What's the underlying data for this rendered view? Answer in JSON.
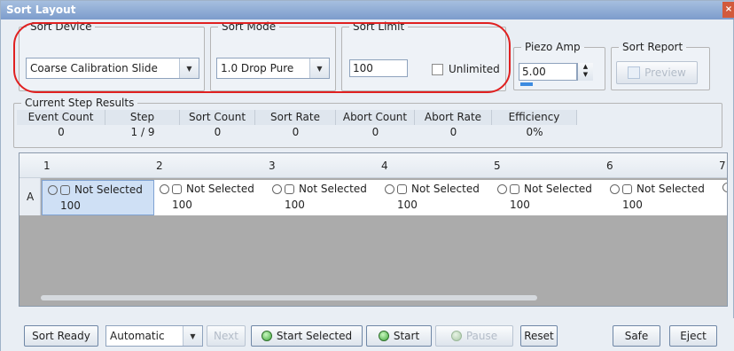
{
  "window": {
    "title": "Sort Layout",
    "close_glyph": "×"
  },
  "sort_device": {
    "legend": "Sort Device",
    "value": "Coarse Calibration Slide"
  },
  "sort_mode": {
    "legend": "Sort Mode",
    "value": "1.0 Drop Pure"
  },
  "sort_limit": {
    "legend": "Sort Limit",
    "value": "100",
    "unlimited_label": "Unlimited",
    "unlimited_checked": false
  },
  "piezo_amp": {
    "legend": "Piezo Amp",
    "value": "5.00"
  },
  "sort_report": {
    "legend": "Sort Report",
    "preview_label": "Preview"
  },
  "current_step": {
    "legend": "Current Step Results",
    "headers": [
      "Event Count",
      "Step",
      "Sort Count",
      "Sort Rate",
      "Abort Count",
      "Abort Rate",
      "Efficiency"
    ],
    "values": [
      "0",
      "1 / 9",
      "0",
      "0",
      "0",
      "0",
      "0%"
    ]
  },
  "grid": {
    "columns": [
      "1",
      "2",
      "3",
      "4",
      "5",
      "6",
      "7"
    ],
    "row_label": "A",
    "cells": [
      {
        "status": "Not Selected",
        "count": "100"
      },
      {
        "status": "Not Selected",
        "count": "100"
      },
      {
        "status": "Not Selected",
        "count": "100"
      },
      {
        "status": "Not Selected",
        "count": "100"
      },
      {
        "status": "Not Selected",
        "count": "100"
      },
      {
        "status": "Not Selected",
        "count": "100"
      }
    ]
  },
  "toolbar": {
    "sort_ready": "Sort Ready",
    "mode_value": "Automatic",
    "next": "Next",
    "start_selected": "Start Selected",
    "start": "Start",
    "pause": "Pause",
    "reset": "Reset",
    "safe": "Safe",
    "eject": "Eject"
  },
  "colors": {
    "highlight": "#e02020",
    "accent": "#3c8be0",
    "led": "#3fa83a"
  }
}
